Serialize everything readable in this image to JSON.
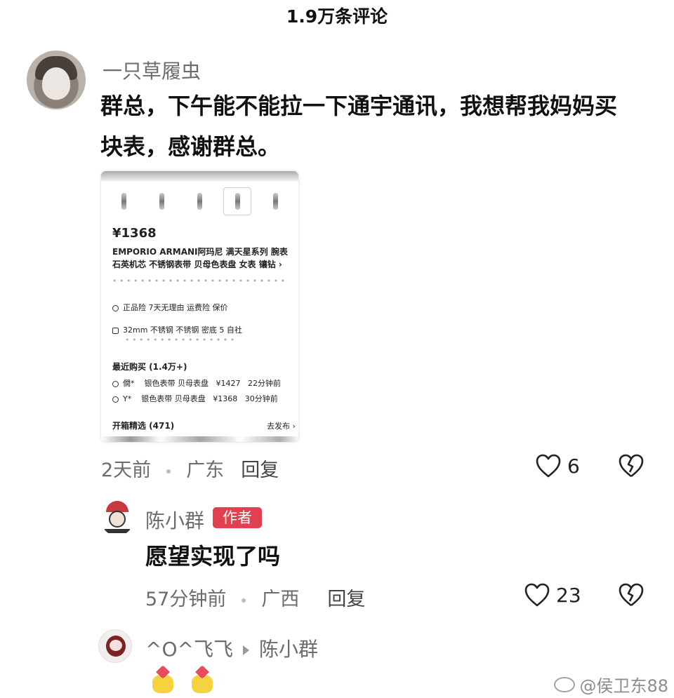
{
  "header": {
    "title": "1.9万条评论"
  },
  "comments": [
    {
      "username": "一只草履虫",
      "text_line1": "群总，下午能不能拉一下通宇通讯，我想帮我妈妈买",
      "text_line2": "块表，感谢群总。",
      "time": "2天前",
      "location": "广东",
      "reply_label": "回复",
      "likes": "6",
      "screenshot": {
        "price": "¥1368",
        "title_line1": "EMPORIO ARMANI阿玛尼 满天星系列 腕表",
        "title_line2": "石英机芯 不锈钢表带 贝母色表盘 女表 镶钻 ›",
        "service_line": "正品险   7天无理由   运费险   保价",
        "spec_line": "32mm   不锈钢   不锈钢   密底   5   自社",
        "recent_title": "最近购买 (1.4万+)",
        "recent_rows": [
          {
            "user": "僩*",
            "desc": "银色表带 贝母表盘",
            "price": "¥1427",
            "time": "22分钟前"
          },
          {
            "user": "Y*",
            "desc": "银色表带 贝母表盘",
            "price": "¥1368",
            "time": "30分钟前"
          }
        ],
        "unbox_title": "开箱精选 (471)",
        "unbox_more": "去发布 ›"
      }
    },
    {
      "username": "陈小群",
      "badge": "作者",
      "text": "愿望实现了吗",
      "time": "57分钟前",
      "location": "广西",
      "reply_label": "回复",
      "likes": "23"
    },
    {
      "username": "^O^飞飞",
      "reply_to": "陈小群"
    }
  ],
  "watermark": "@侯卫东88"
}
